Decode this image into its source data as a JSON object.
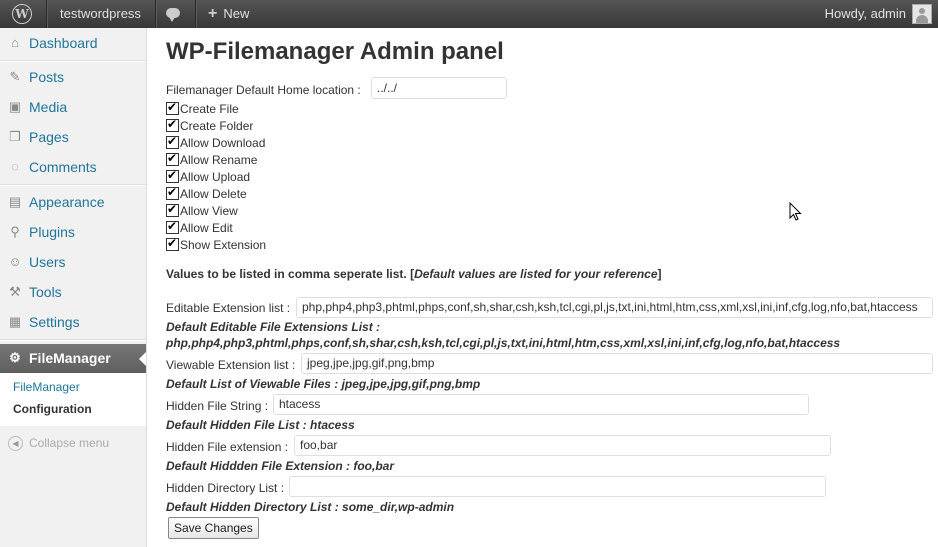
{
  "adminbar": {
    "site_name": "testwordpress",
    "new_label": "New",
    "howdy": "Howdy, admin"
  },
  "sidebar": {
    "items": [
      {
        "label": "Dashboard",
        "icon": "dashboard-icon"
      },
      {
        "label": "Posts",
        "icon": "pin-icon"
      },
      {
        "label": "Media",
        "icon": "media-icon"
      },
      {
        "label": "Pages",
        "icon": "pages-icon"
      },
      {
        "label": "Comments",
        "icon": "comments-icon"
      },
      {
        "label": "Appearance",
        "icon": "appearance-icon"
      },
      {
        "label": "Plugins",
        "icon": "plugin-icon"
      },
      {
        "label": "Users",
        "icon": "users-icon"
      },
      {
        "label": "Tools",
        "icon": "tools-icon"
      },
      {
        "label": "Settings",
        "icon": "settings-icon"
      }
    ],
    "active": {
      "label": "FileManager",
      "icon": "gear-icon"
    },
    "submenu": [
      "FileManager",
      "Configuration"
    ],
    "collapse_label": "Collapse menu"
  },
  "main": {
    "title": "WP-Filemanager Admin panel",
    "home_location_label": "Filemanager Default Home location :",
    "home_location_value": "../../",
    "checkboxes": [
      "Create File",
      "Create Folder",
      "Allow Download",
      "Allow Rename",
      "Allow Upload",
      "Allow Delete",
      "Allow View",
      "Allow Edit",
      "Show Extension"
    ],
    "values_note": "Values to be listed in comma seperate list. [",
    "values_note_em": "Default values are listed for your reference",
    "values_note_end": "]",
    "editable_label": "Editable Extension list :",
    "editable_value": "php,php4,php3,phtml,phps,conf,sh,shar,csh,ksh,tcl,cgi,pl,js,txt,ini,html,htm,css,xml,xsl,ini,inf,cfg,log,nfo,bat,htaccess",
    "editable_default_title": "Default Editable File Extensions List :",
    "editable_default_value": "php,php4,php3,phtml,phps,conf,sh,shar,csh,ksh,tcl,cgi,pl,js,txt,ini,html,htm,css,xml,xsl,ini,inf,cfg,log,nfo,bat,htaccess",
    "viewable_label": "Viewable Extension list :",
    "viewable_value": "jpeg,jpe,jpg,gif,png,bmp",
    "viewable_default": "Default List of Viewable Files : jpeg,jpe,jpg,gif,png,bmp",
    "hidden_string_label": "Hidden File String :",
    "hidden_string_value": "htacess",
    "hidden_string_default": "Default Hidden File List : htacess",
    "hidden_ext_label": "Hidden File extension :",
    "hidden_ext_value": "foo,bar",
    "hidden_ext_default": "Default Hiddden File Extension : foo,bar",
    "hidden_dir_label": "Hidden Directory List :",
    "hidden_dir_value": "",
    "hidden_dir_default": "Default Hidden Directory List : some_dir,wp-admin",
    "save_label": "Save Changes"
  }
}
